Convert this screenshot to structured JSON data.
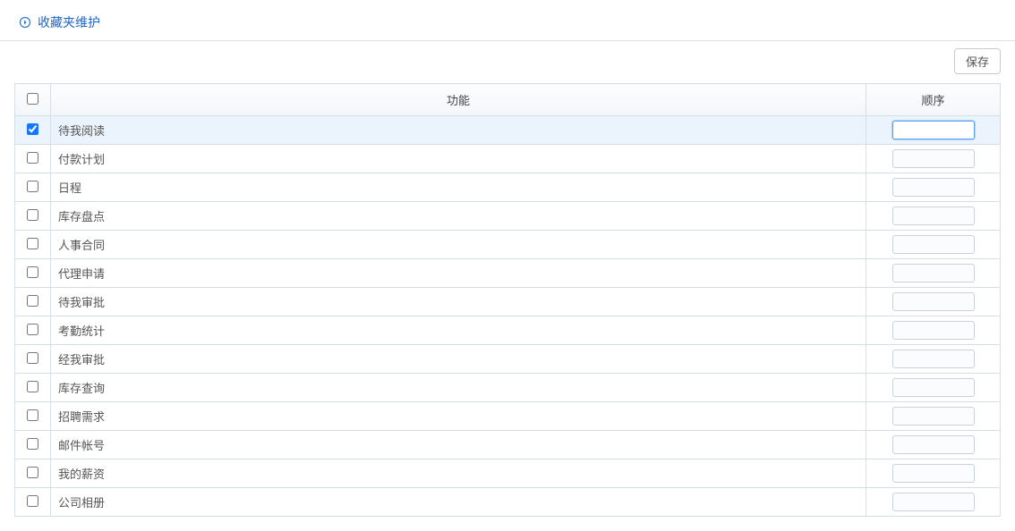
{
  "header": {
    "title": "收藏夹维护"
  },
  "toolbar": {
    "save_label": "保存"
  },
  "table": {
    "columns": {
      "function": "功能",
      "order": "顺序"
    },
    "rows": [
      {
        "checked": true,
        "function": "待我阅读",
        "order": ""
      },
      {
        "checked": false,
        "function": "付款计划",
        "order": ""
      },
      {
        "checked": false,
        "function": "日程",
        "order": ""
      },
      {
        "checked": false,
        "function": "库存盘点",
        "order": ""
      },
      {
        "checked": false,
        "function": "人事合同",
        "order": ""
      },
      {
        "checked": false,
        "function": "代理申请",
        "order": ""
      },
      {
        "checked": false,
        "function": "待我审批",
        "order": ""
      },
      {
        "checked": false,
        "function": "考勤统计",
        "order": ""
      },
      {
        "checked": false,
        "function": "经我审批",
        "order": ""
      },
      {
        "checked": false,
        "function": "库存查询",
        "order": ""
      },
      {
        "checked": false,
        "function": "招聘需求",
        "order": ""
      },
      {
        "checked": false,
        "function": "邮件帐号",
        "order": ""
      },
      {
        "checked": false,
        "function": "我的薪资",
        "order": ""
      },
      {
        "checked": false,
        "function": "公司相册",
        "order": ""
      }
    ]
  }
}
